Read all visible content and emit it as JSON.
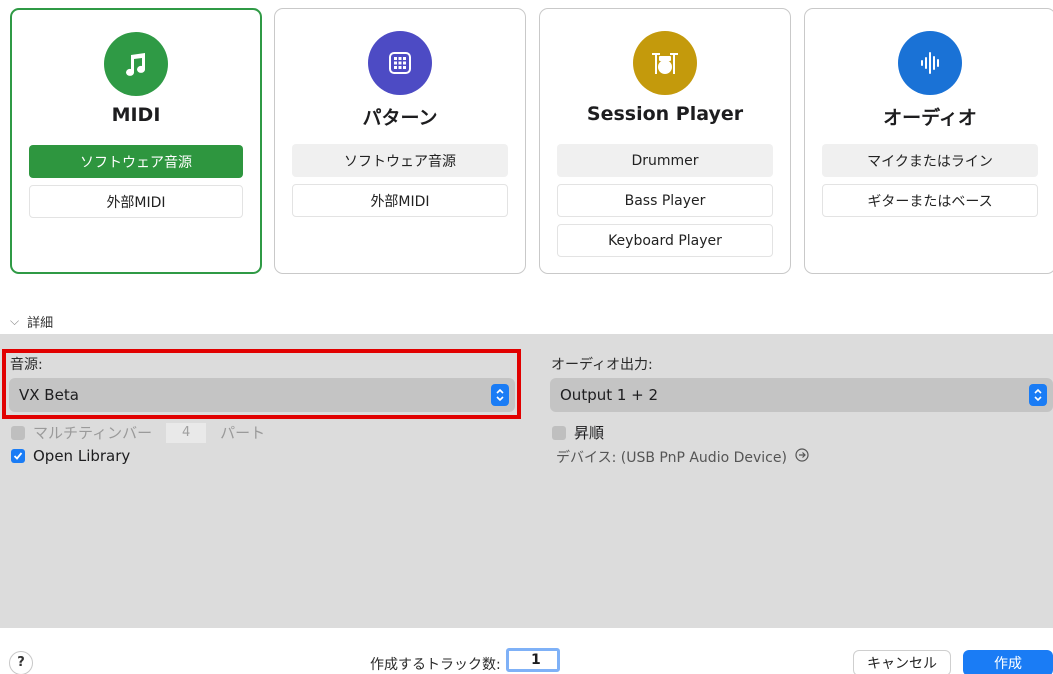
{
  "cards": [
    {
      "title": "MIDI",
      "icon": "music-note-icon",
      "color": "#2f9a45",
      "selected": true,
      "options": [
        "ソフトウェア音源",
        "外部MIDI"
      ]
    },
    {
      "title": "パターン",
      "icon": "pattern-grid-icon",
      "color": "#4d4bc4",
      "selected": false,
      "options": [
        "ソフトウェア音源",
        "外部MIDI"
      ]
    },
    {
      "title": "Session Player",
      "icon": "drum-kit-icon",
      "color": "#c49a0c",
      "selected": false,
      "options": [
        "Drummer",
        "Bass Player",
        "Keyboard Player"
      ]
    },
    {
      "title": "オーディオ",
      "icon": "waveform-icon",
      "color": "#1a72d6",
      "selected": false,
      "options": [
        "マイクまたはライン",
        "ギターまたはベース"
      ]
    }
  ],
  "details": {
    "label": "詳細"
  },
  "instrument": {
    "label": "音源:",
    "value": "VX Beta"
  },
  "audio_output": {
    "label": "オーディオ出力:",
    "value": "Output 1 + 2"
  },
  "multitimbral": {
    "label": "マルチティンバー",
    "value": "4",
    "suffix": "パート",
    "checked": false
  },
  "open_library": {
    "label": "Open Library",
    "checked": true
  },
  "ascending": {
    "label": "昇順",
    "checked": false
  },
  "device": {
    "text": "デバイス: (USB PnP Audio Device)"
  },
  "footer": {
    "help": "?",
    "track_count_label": "作成するトラック数:",
    "track_count": "1",
    "cancel": "キャンセル",
    "create": "作成"
  },
  "colors": {
    "accent": "#1a7cf5",
    "selected_green": "#2e963f",
    "highlight": "#e10000"
  }
}
